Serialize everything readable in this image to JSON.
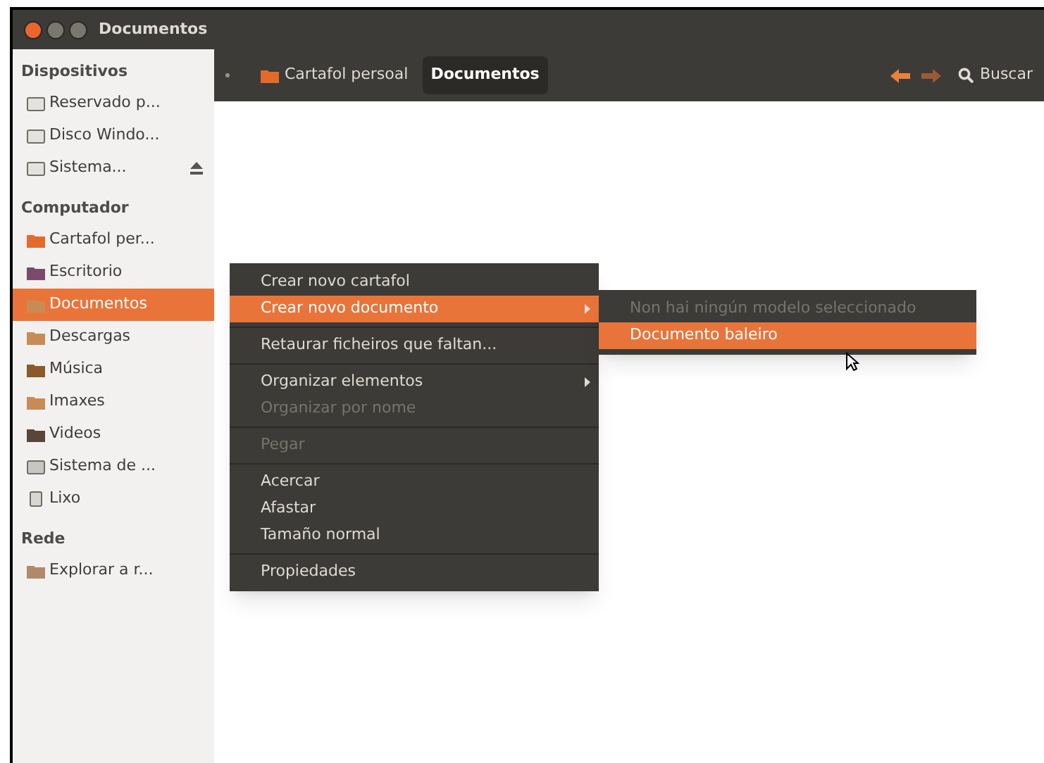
{
  "window": {
    "title": "Documentos"
  },
  "sidebar": {
    "sections": [
      {
        "title": "Dispositivos",
        "items": [
          {
            "label": "Reservado p...",
            "kind": "drive",
            "selected": false,
            "eject": false
          },
          {
            "label": "Disco Windo...",
            "kind": "drive",
            "selected": false,
            "eject": false
          },
          {
            "label": "Sistema...",
            "kind": "drive",
            "selected": false,
            "eject": true
          }
        ]
      },
      {
        "title": "Computador",
        "items": [
          {
            "label": "Cartafol per...",
            "kind": "home",
            "selected": false,
            "eject": false
          },
          {
            "label": "Escritorio",
            "kind": "desktop",
            "selected": false,
            "eject": false
          },
          {
            "label": "Documentos",
            "kind": "folder",
            "selected": true,
            "eject": false
          },
          {
            "label": "Descargas",
            "kind": "folder",
            "selected": false,
            "eject": false
          },
          {
            "label": "Música",
            "kind": "music",
            "selected": false,
            "eject": false
          },
          {
            "label": "Imaxes",
            "kind": "folder",
            "selected": false,
            "eject": false
          },
          {
            "label": "Videos",
            "kind": "video",
            "selected": false,
            "eject": false
          },
          {
            "label": "Sistema de ...",
            "kind": "filesystem",
            "selected": false,
            "eject": false
          },
          {
            "label": "Lixo",
            "kind": "trash",
            "selected": false,
            "eject": false
          }
        ]
      },
      {
        "title": "Rede",
        "items": [
          {
            "label": "Explorar a r...",
            "kind": "network",
            "selected": false,
            "eject": false
          }
        ]
      }
    ]
  },
  "toolbar": {
    "path": [
      {
        "label": "Cartafol persoal",
        "selected": false
      },
      {
        "label": "Documentos",
        "selected": true
      }
    ],
    "search": "Buscar"
  },
  "context_menu": {
    "items": [
      {
        "kind": "item",
        "label": "Crear novo cartafol",
        "selected": false,
        "disabled": false,
        "submenu": false
      },
      {
        "kind": "item",
        "label": "Crear novo documento",
        "selected": true,
        "disabled": false,
        "submenu": true
      },
      {
        "kind": "separator"
      },
      {
        "kind": "item",
        "label": "Retaurar ficheiros que faltan...",
        "selected": false,
        "disabled": false,
        "submenu": false
      },
      {
        "kind": "separator"
      },
      {
        "kind": "item",
        "label": "Organizar elementos",
        "selected": false,
        "disabled": false,
        "submenu": true
      },
      {
        "kind": "item",
        "label": "Organizar por nome",
        "selected": false,
        "disabled": true,
        "submenu": false
      },
      {
        "kind": "separator"
      },
      {
        "kind": "item",
        "label": "Pegar",
        "selected": false,
        "disabled": true,
        "submenu": false
      },
      {
        "kind": "separator"
      },
      {
        "kind": "item",
        "label": "Acercar",
        "selected": false,
        "disabled": false,
        "submenu": false
      },
      {
        "kind": "item",
        "label": "Afastar",
        "selected": false,
        "disabled": false,
        "submenu": false
      },
      {
        "kind": "item",
        "label": "Tamaño normal",
        "selected": false,
        "disabled": false,
        "submenu": false
      },
      {
        "kind": "separator"
      },
      {
        "kind": "item",
        "label": "Propiedades",
        "selected": false,
        "disabled": false,
        "submenu": false
      }
    ]
  },
  "submenu": {
    "items": [
      {
        "kind": "item",
        "label": "Non hai ningún modelo seleccionado",
        "selected": false,
        "disabled": true,
        "submenu": false
      },
      {
        "kind": "item",
        "label": "Documento baleiro",
        "selected": true,
        "disabled": false,
        "submenu": false
      }
    ]
  }
}
